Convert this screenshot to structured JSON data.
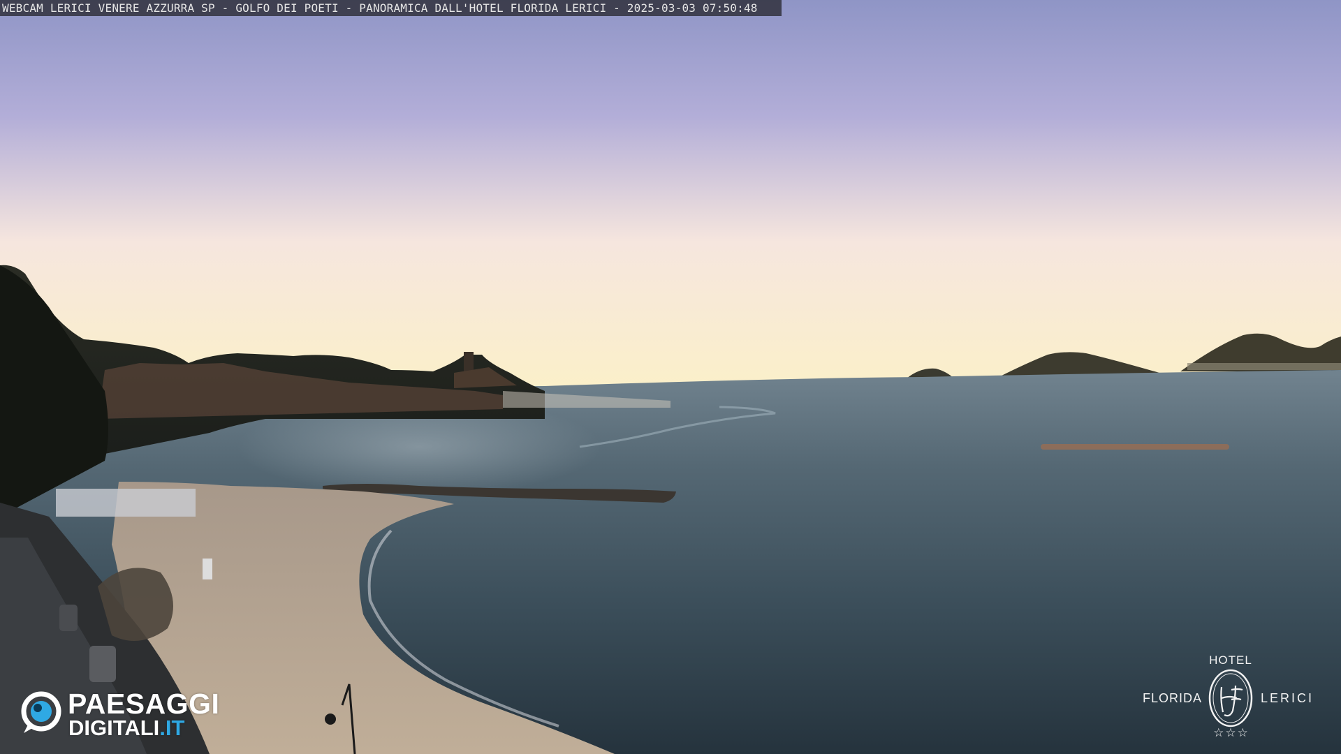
{
  "overlay": {
    "caption": "WEBCAM LERICI VENERE AZZURRA SP - GOLFO DEI POETI - PANORAMICA DALL'HOTEL FLORIDA LERICI - 2025-03-03 07:50:48"
  },
  "logos": {
    "paesaggi": {
      "line1": "PAESAGGI",
      "line2_main": "DIGITALI",
      "line2_tld": ".IT",
      "icon": "eye-icon",
      "accent_color": "#2fa9e4"
    },
    "hotel": {
      "top_label": "HOTEL",
      "left_label": "FLORIDA",
      "right_label": "LERICI",
      "monogram": "HF",
      "stars": "☆☆☆"
    }
  },
  "scene": {
    "sky_colors": [
      "#8f95c6",
      "#b3aed8",
      "#f6e6de",
      "#fbf0c9"
    ],
    "sea_colors": [
      "#71838f",
      "#3c4f5b",
      "#25333d"
    ],
    "sand_color": "#b9a894"
  }
}
